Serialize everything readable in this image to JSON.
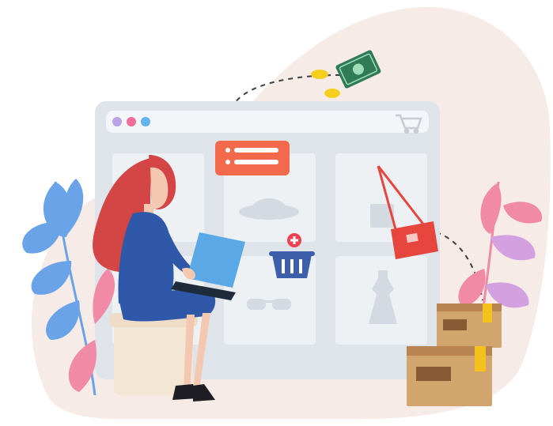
{
  "scene": {
    "kind": "online-shopping-illustration",
    "colors": {
      "blob": "#f6ebe7",
      "window": "#dfe4ea",
      "window_dark": "#cfd6de",
      "card": "#eef1f4",
      "dot_purple": "#b9a3e6",
      "dot_pink": "#ef6f9a",
      "dot_blue": "#62b4ee",
      "tag": "#f26a4b",
      "bag": "#e7463e",
      "basket": "#3d5ea8",
      "plus": "#ef4353",
      "money": "#2f7a57",
      "coin": "#f5cf1d",
      "hair": "#d44646",
      "dress": "#2f59a8",
      "skin": "#f4c7b0",
      "laptop": "#5aa9e6",
      "stool": "#f4e6d5",
      "box": "#d2a56f",
      "box_dark": "#b88452",
      "box_tape": "#f5c11d",
      "plant_blue": "#6aa3e8",
      "plant_pink": "#f08aa6",
      "plant_lilac": "#d3a0e0"
    },
    "icons": [
      "cart-icon",
      "hat-icon",
      "sunglasses-icon",
      "dress-icon",
      "bag-icon",
      "basket-icon",
      "plus-icon",
      "banknote-icon",
      "coin-icon",
      "price-tag-icon"
    ]
  }
}
